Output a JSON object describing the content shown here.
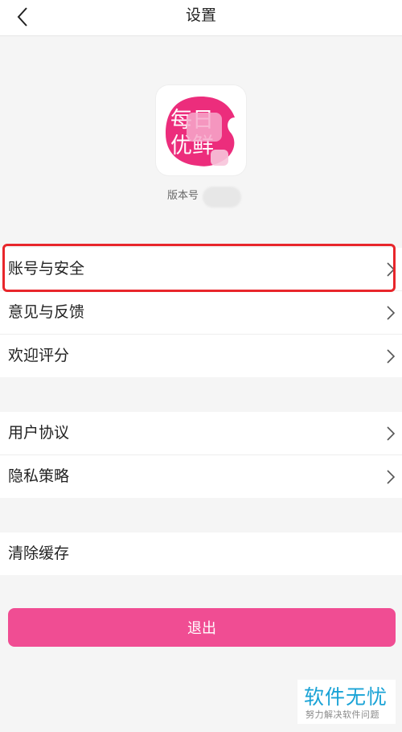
{
  "header": {
    "title": "设置",
    "back_icon": "chevron-left-icon"
  },
  "app": {
    "logo_text_line1": "每日",
    "logo_text_line2": "优鲜",
    "logo_color": "#ec2d7c",
    "version_label": "版本号"
  },
  "sections": [
    {
      "items": [
        {
          "label": "账号与安全"
        },
        {
          "label": "意见与反馈"
        },
        {
          "label": "欢迎评分"
        }
      ]
    },
    {
      "items": [
        {
          "label": "用户协议"
        },
        {
          "label": "隐私策略"
        }
      ]
    },
    {
      "items": [
        {
          "label": "清除缓存"
        }
      ]
    }
  ],
  "logout": {
    "label": "退出",
    "color": "#f04d93"
  },
  "highlight_color": "#e8262b",
  "watermark": {
    "title": "软件无忧",
    "subtitle": "努力解决软件问题"
  }
}
